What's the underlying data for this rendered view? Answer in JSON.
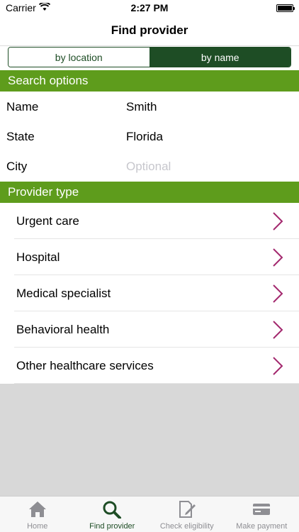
{
  "status": {
    "carrier": "Carrier",
    "time": "2:27 PM"
  },
  "nav": {
    "title": "Find provider"
  },
  "segment": {
    "options": [
      "by location",
      "by name"
    ],
    "selected": "by name"
  },
  "search_options": {
    "header": "Search options",
    "fields": [
      {
        "label": "Name",
        "value": "Smith"
      },
      {
        "label": "State",
        "value": "Florida"
      },
      {
        "label": "City",
        "value": "",
        "placeholder": "Optional"
      }
    ]
  },
  "provider_type": {
    "header": "Provider type",
    "items": [
      {
        "label": "Urgent care"
      },
      {
        "label": "Hospital"
      },
      {
        "label": "Medical specialist"
      },
      {
        "label": "Behavioral health"
      },
      {
        "label": "Other healthcare services"
      }
    ]
  },
  "tab_bar": {
    "tabs": [
      {
        "label": "Home",
        "icon": "home-icon"
      },
      {
        "label": "Find provider",
        "icon": "search-icon",
        "active": true
      },
      {
        "label": "Check eligibility",
        "icon": "edit-document-icon"
      },
      {
        "label": "Make payment",
        "icon": "credit-card-icon"
      }
    ]
  },
  "colors": {
    "primary_dark_green": "#1e4d25",
    "section_green": "#5e9c1c",
    "chevron": "#a3286e"
  }
}
